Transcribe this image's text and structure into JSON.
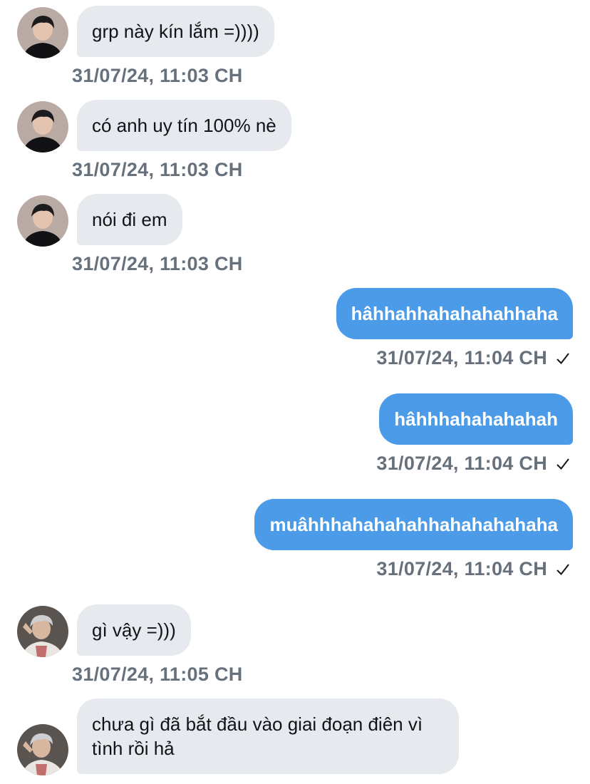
{
  "messages": [
    {
      "direction": "in",
      "text": "grp này kín lắm =))))",
      "timestamp": "31/07/24, 11:03 CH"
    },
    {
      "direction": "in",
      "text": "có anh uy tín 100% nè",
      "timestamp": "31/07/24, 11:03 CH"
    },
    {
      "direction": "in",
      "text": "nói đi em",
      "timestamp": "31/07/24, 11:03 CH"
    },
    {
      "direction": "out",
      "text": "hâhhahhahahahahhaha",
      "timestamp": "31/07/24, 11:04 CH",
      "status_icon": "checkmark-icon"
    },
    {
      "direction": "out",
      "text": "hâhhhahahahahah",
      "timestamp": "31/07/24, 11:04 CH",
      "status_icon": "checkmark-icon"
    },
    {
      "direction": "out",
      "text": "muâhhhahahahahhahahahahaha",
      "timestamp": "31/07/24, 11:04 CH",
      "status_icon": "checkmark-icon"
    },
    {
      "direction": "in",
      "text": "gì vậy =)))",
      "timestamp": "31/07/24, 11:05 CH"
    },
    {
      "direction": "in",
      "text": "chưa gì đã bắt đầu vào giai đoạn điên vì tình rồi hả"
    }
  ],
  "colors": {
    "incoming_bubble": "#e6e9ed",
    "outgoing_bubble": "#4c9be8",
    "timestamp": "#66717c"
  }
}
